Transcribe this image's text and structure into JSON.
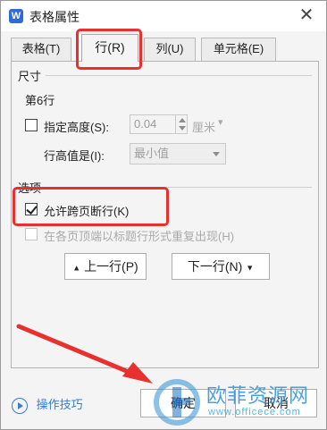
{
  "dialog": {
    "title": "表格属性",
    "app_icon": "W",
    "close_label": "✕"
  },
  "tabs": [
    {
      "label": "表格(T)",
      "active": false
    },
    {
      "label": "行(R)",
      "active": true
    },
    {
      "label": "列(U)",
      "active": false
    },
    {
      "label": "单元格(E)",
      "active": false
    }
  ],
  "size_section": {
    "heading": "尺寸",
    "row_label": "第6行",
    "specify_height_label": "指定高度(S):",
    "specify_height_checked": false,
    "height_value": "0.04",
    "height_unit": "厘米",
    "height_rule_label": "行高值是(I):",
    "height_rule_value": "最小值"
  },
  "options_section": {
    "heading": "选项",
    "allow_break_label": "允许跨页断行(K)",
    "allow_break_checked": true,
    "repeat_header_label": "在各页顶端以标题行形式重复出现(H)",
    "repeat_header_checked": false
  },
  "nav": {
    "prev_row": "上一行(P)",
    "next_row": "下一行(N)"
  },
  "footer": {
    "help_label": "操作技巧",
    "ok_label": "确定",
    "cancel_label": "取消"
  },
  "watermark": {
    "title": "欧菲资源网",
    "domain": "www.officece.com"
  },
  "colors": {
    "highlight": "#e8302f",
    "link": "#3a7bd5"
  }
}
